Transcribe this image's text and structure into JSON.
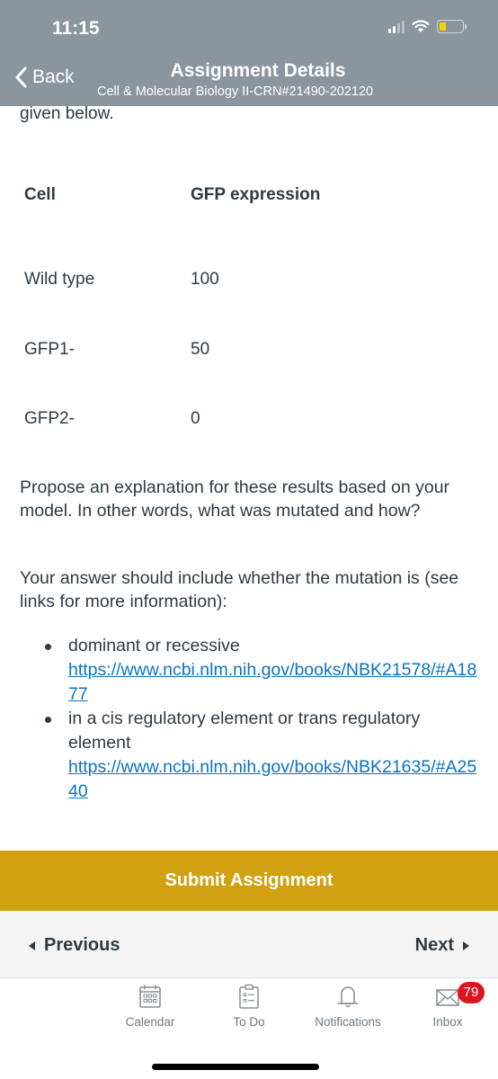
{
  "status_bar": {
    "time": "11:15",
    "battery_level_percent": 15,
    "battery_color": "#f5d000"
  },
  "header": {
    "back_label": "Back",
    "title": "Assignment Details",
    "subtitle": "Cell & Molecular Biology II-CRN#21490-202120",
    "background": "#8b959e"
  },
  "content": {
    "intro_fragment": "given below.",
    "table": {
      "headers": [
        "Cell",
        "GFP expression"
      ],
      "rows": [
        [
          "Wild type",
          "100"
        ],
        [
          "GFP1-",
          "50"
        ],
        [
          "GFP2-",
          "0"
        ]
      ]
    },
    "question": "Propose an explanation for these results based on your model. In other words, what was mutated and how?",
    "instruction": "Your answer should include whether the mutation is (see links for more information):",
    "bullets": [
      {
        "text": "dominant or recessive",
        "link": "https://www.ncbi.nlm.nih.gov/books/NBK21578/#A1877"
      },
      {
        "text": "in a cis regulatory element or trans regulatory element",
        "link": "https://www.ncbi.nlm.nih.gov/books/NBK21635/#A2540"
      }
    ]
  },
  "actions": {
    "submit_label": "Submit Assignment",
    "submit_color": "#d1a112",
    "previous_label": "Previous",
    "next_label": "Next"
  },
  "tabbar": {
    "items": [
      {
        "label": "Calendar",
        "icon": "calendar-icon"
      },
      {
        "label": "To Do",
        "icon": "todo-icon"
      },
      {
        "label": "Notifications",
        "icon": "bell-icon"
      },
      {
        "label": "Inbox",
        "icon": "mail-icon",
        "badge": "79"
      }
    ]
  }
}
